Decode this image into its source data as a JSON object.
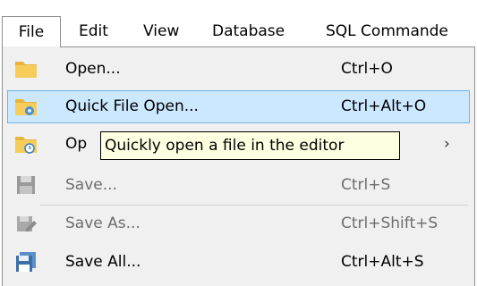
{
  "menubar": {
    "items": [
      {
        "label": "File"
      },
      {
        "label": "Edit"
      },
      {
        "label": "View"
      },
      {
        "label": "Database"
      },
      {
        "label": "SQL Commande"
      }
    ]
  },
  "file_menu": {
    "items": [
      {
        "label": "Open...",
        "shortcut": "Ctrl+O",
        "icon": "folder-icon",
        "enabled": true
      },
      {
        "label": "Quick File Open...",
        "shortcut": "Ctrl+Alt+O",
        "icon": "folder-gear-icon",
        "enabled": true,
        "highlighted": true
      },
      {
        "label": "Op",
        "shortcut": "",
        "icon": "folder-clock-icon",
        "enabled": true,
        "has_submenu": true,
        "submenu_arrow": "›"
      },
      {
        "label": "Save...",
        "shortcut": "Ctrl+S",
        "icon": "save-icon",
        "enabled": false
      },
      {
        "label": "Save As...",
        "shortcut": "Ctrl+Shift+S",
        "icon": "save-as-icon",
        "enabled": false
      },
      {
        "label": "Save All...",
        "shortcut": "Ctrl+Alt+S",
        "icon": "save-all-icon",
        "enabled": true
      }
    ]
  },
  "tooltip": {
    "text": "Quickly open a file in the editor"
  },
  "colors": {
    "highlight_bg": "#cce8ff",
    "highlight_border": "#6fb3e8",
    "tooltip_bg": "#ffffe1",
    "menu_bg": "#f0f0f0",
    "folder": "#f2c44f"
  }
}
